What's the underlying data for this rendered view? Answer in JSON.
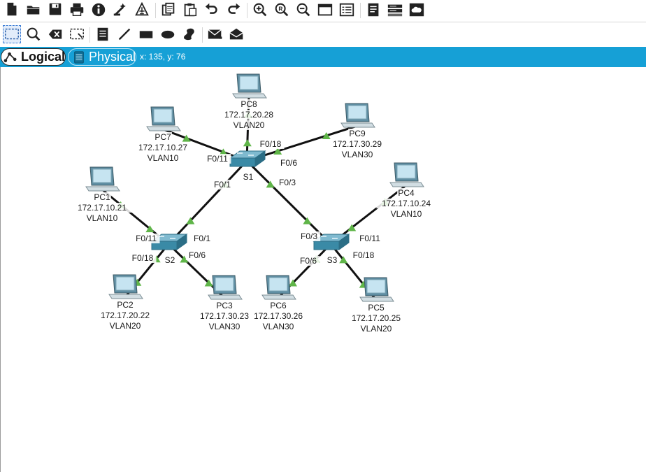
{
  "toolbar_top": [
    {
      "name": "new-file-icon",
      "icon": "file"
    },
    {
      "name": "open-folder-icon",
      "icon": "folder"
    },
    {
      "name": "save-icon",
      "icon": "floppy"
    },
    {
      "name": "print-icon",
      "icon": "printer"
    },
    {
      "name": "info-icon",
      "icon": "info"
    },
    {
      "name": "activity-wizard-icon",
      "icon": "wizard"
    },
    {
      "name": "network-information-icon",
      "icon": "network-info"
    },
    {
      "name": "copy-icon",
      "icon": "copy"
    },
    {
      "name": "paste-icon",
      "icon": "paste"
    },
    {
      "name": "undo-icon",
      "icon": "undo"
    },
    {
      "name": "redo-icon",
      "icon": "redo"
    },
    {
      "name": "zoom-in-icon",
      "icon": "zoom-in"
    },
    {
      "name": "zoom-reset-icon",
      "icon": "zoom-reset"
    },
    {
      "name": "zoom-out-icon",
      "icon": "zoom-out"
    },
    {
      "name": "drawing-palette-icon",
      "icon": "window"
    },
    {
      "name": "custom-devices-dialog-icon",
      "icon": "dialog"
    },
    {
      "name": "view-command-log-icon",
      "icon": "log"
    },
    {
      "name": "device-rack-icon",
      "icon": "rack"
    },
    {
      "name": "cloud-icon",
      "icon": "cloud"
    }
  ],
  "toolbar_bottom": [
    {
      "name": "select-icon",
      "icon": "select",
      "selected": true
    },
    {
      "name": "inspect-icon",
      "icon": "magnifier"
    },
    {
      "name": "delete-icon",
      "icon": "delete"
    },
    {
      "name": "resize-shape-icon",
      "icon": "resize"
    },
    {
      "name": "place-note-icon",
      "icon": "note"
    },
    {
      "name": "draw-line-icon",
      "icon": "line"
    },
    {
      "name": "draw-rectangle-icon",
      "icon": "rectangle"
    },
    {
      "name": "draw-ellipse-icon",
      "icon": "ellipse"
    },
    {
      "name": "freeform-draw-icon",
      "icon": "freeform"
    },
    {
      "name": "add-simple-pdu-icon",
      "icon": "envelope"
    },
    {
      "name": "add-complex-pdu-icon",
      "icon": "envelope-open"
    }
  ],
  "tabs": {
    "logical": "Logical",
    "physical": "Physical",
    "coordinates": "x: 135, y: 76"
  },
  "colors": {
    "tab_bar": "#16a0d6",
    "link": "#111111",
    "link_up": "#5fb548",
    "switch": "#3a8aa6"
  },
  "topology": {
    "switches": [
      {
        "id": "S1",
        "label": "S1"
      },
      {
        "id": "S2",
        "label": "S2"
      },
      {
        "id": "S3",
        "label": "S3"
      }
    ],
    "pcs": [
      {
        "id": "PC1",
        "name": "PC1",
        "ip": "172.17.10.21",
        "vlan": "VLAN10"
      },
      {
        "id": "PC2",
        "name": "PC2",
        "ip": "172.17.20.22",
        "vlan": "VLAN20"
      },
      {
        "id": "PC3",
        "name": "PC3",
        "ip": "172.17.30.23",
        "vlan": "VLAN30"
      },
      {
        "id": "PC4",
        "name": "PC4",
        "ip": "172.17.10.24",
        "vlan": "VLAN10"
      },
      {
        "id": "PC5",
        "name": "PC5",
        "ip": "172.17.20.25",
        "vlan": "VLAN20"
      },
      {
        "id": "PC6",
        "name": "PC6",
        "ip": "172.17.30.26",
        "vlan": "VLAN30"
      },
      {
        "id": "PC7",
        "name": "PC7",
        "ip": "172.17.10.27",
        "vlan": "VLAN10"
      },
      {
        "id": "PC8",
        "name": "PC8",
        "ip": "172.17.20.28",
        "vlan": "VLAN20"
      },
      {
        "id": "PC9",
        "name": "PC9",
        "ip": "172.17.30.29",
        "vlan": "VLAN30"
      }
    ],
    "links": [
      {
        "a": "S1",
        "b": "S2",
        "port_a": "F0/1",
        "port_b": "F0/1"
      },
      {
        "a": "S1",
        "b": "S3",
        "port_a": "F0/3",
        "port_b": "F0/3"
      },
      {
        "a": "S1",
        "b": "PC7",
        "port_a": "F0/11"
      },
      {
        "a": "S1",
        "b": "PC8",
        "port_a": "F0/18"
      },
      {
        "a": "S1",
        "b": "PC9",
        "port_a": "F0/6"
      },
      {
        "a": "S2",
        "b": "PC1",
        "port_a": "F0/11"
      },
      {
        "a": "S2",
        "b": "PC2",
        "port_a": "F0/18"
      },
      {
        "a": "S2",
        "b": "PC3",
        "port_a": "F0/6"
      },
      {
        "a": "S3",
        "b": "PC4",
        "port_a": "F0/11"
      },
      {
        "a": "S3",
        "b": "PC5",
        "port_a": "F0/18"
      },
      {
        "a": "S3",
        "b": "PC6",
        "port_a": "F0/6"
      }
    ]
  }
}
